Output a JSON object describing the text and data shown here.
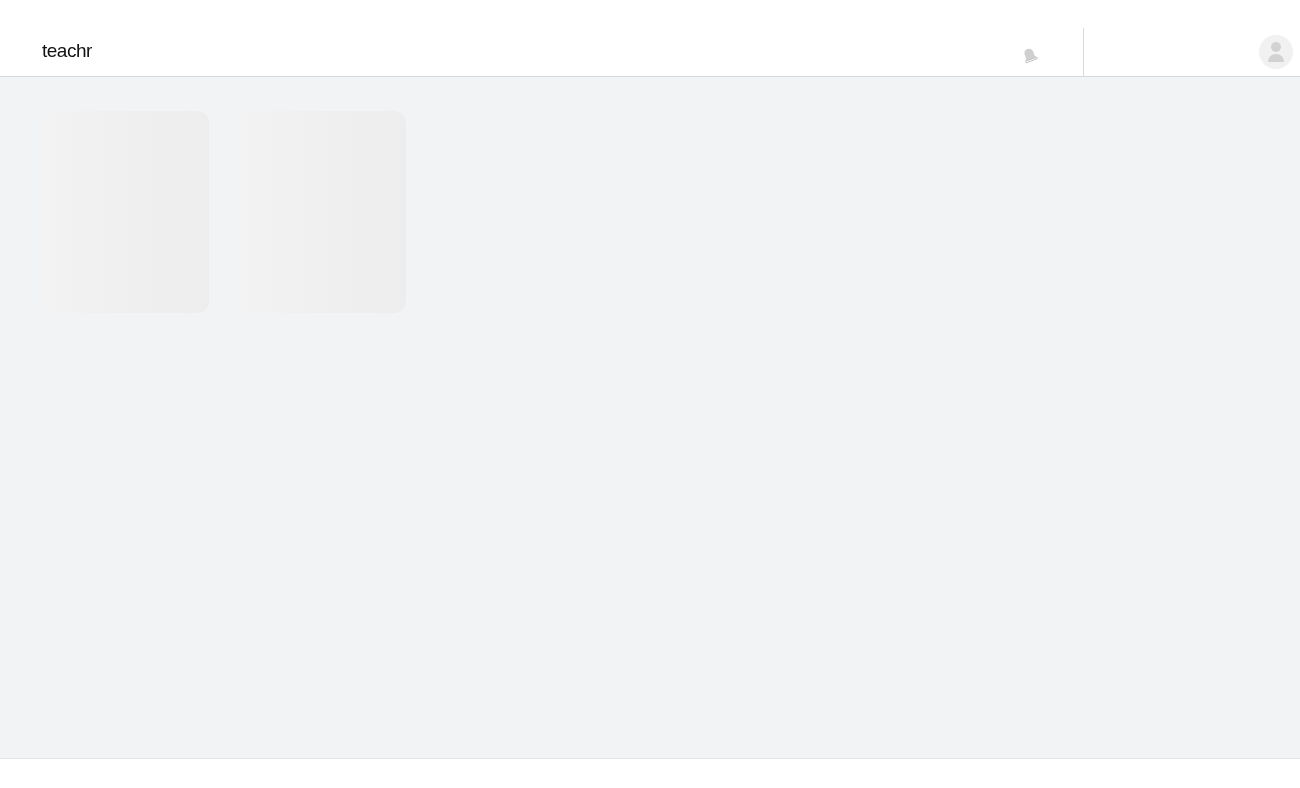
{
  "header": {
    "logo": "teachr"
  },
  "cards": [
    {
      "kind": "skeleton"
    },
    {
      "kind": "skeleton"
    }
  ]
}
